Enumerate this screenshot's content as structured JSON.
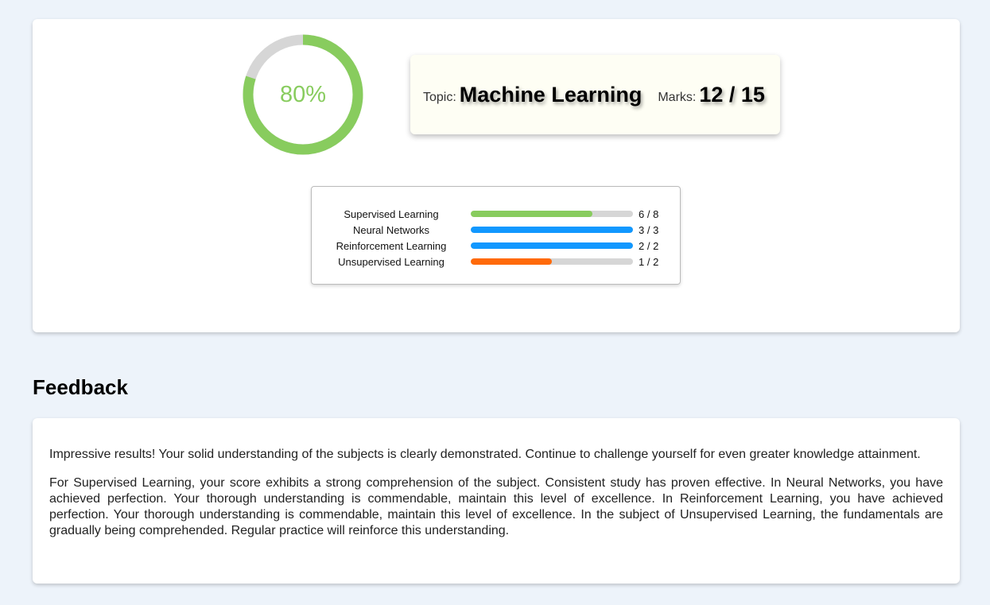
{
  "score": {
    "percent": 80,
    "label": "80%",
    "color": "#88cc5e",
    "track_color": "#d6d6d6"
  },
  "info": {
    "topic_label": "Topic:",
    "topic": "Machine Learning",
    "marks_label": "Marks:",
    "marks": "12 / 15"
  },
  "subjects": [
    {
      "name": "Supervised Learning",
      "score": 6,
      "total": 8,
      "value": "6 / 8",
      "color": "#88cc5e"
    },
    {
      "name": "Neural Networks",
      "score": 3,
      "total": 3,
      "value": "3 / 3",
      "color": "#1198ff"
    },
    {
      "name": "Reinforcement Learning",
      "score": 2,
      "total": 2,
      "value": "2 / 2",
      "color": "#1198ff"
    },
    {
      "name": "Unsupervised Learning",
      "score": 1,
      "total": 2,
      "value": "1 / 2",
      "color": "#ff6a0a"
    }
  ],
  "feedback": {
    "title": "Feedback",
    "paragraphs": [
      "Impressive results! Your solid understanding of the subjects is clearly demonstrated. Continue to challenge yourself for even greater knowledge attainment.",
      "For Supervised Learning, your score exhibits a strong comprehension of the subject. Consistent study has proven effective. In Neural Networks, you have achieved perfection. Your thorough understanding is commendable, maintain this level of excellence. In Reinforcement Learning, you have achieved perfection. Your thorough understanding is commendable, maintain this level of excellence. In the subject of Unsupervised Learning, the fundamentals are gradually being comprehended. Regular practice will reinforce this understanding."
    ]
  }
}
